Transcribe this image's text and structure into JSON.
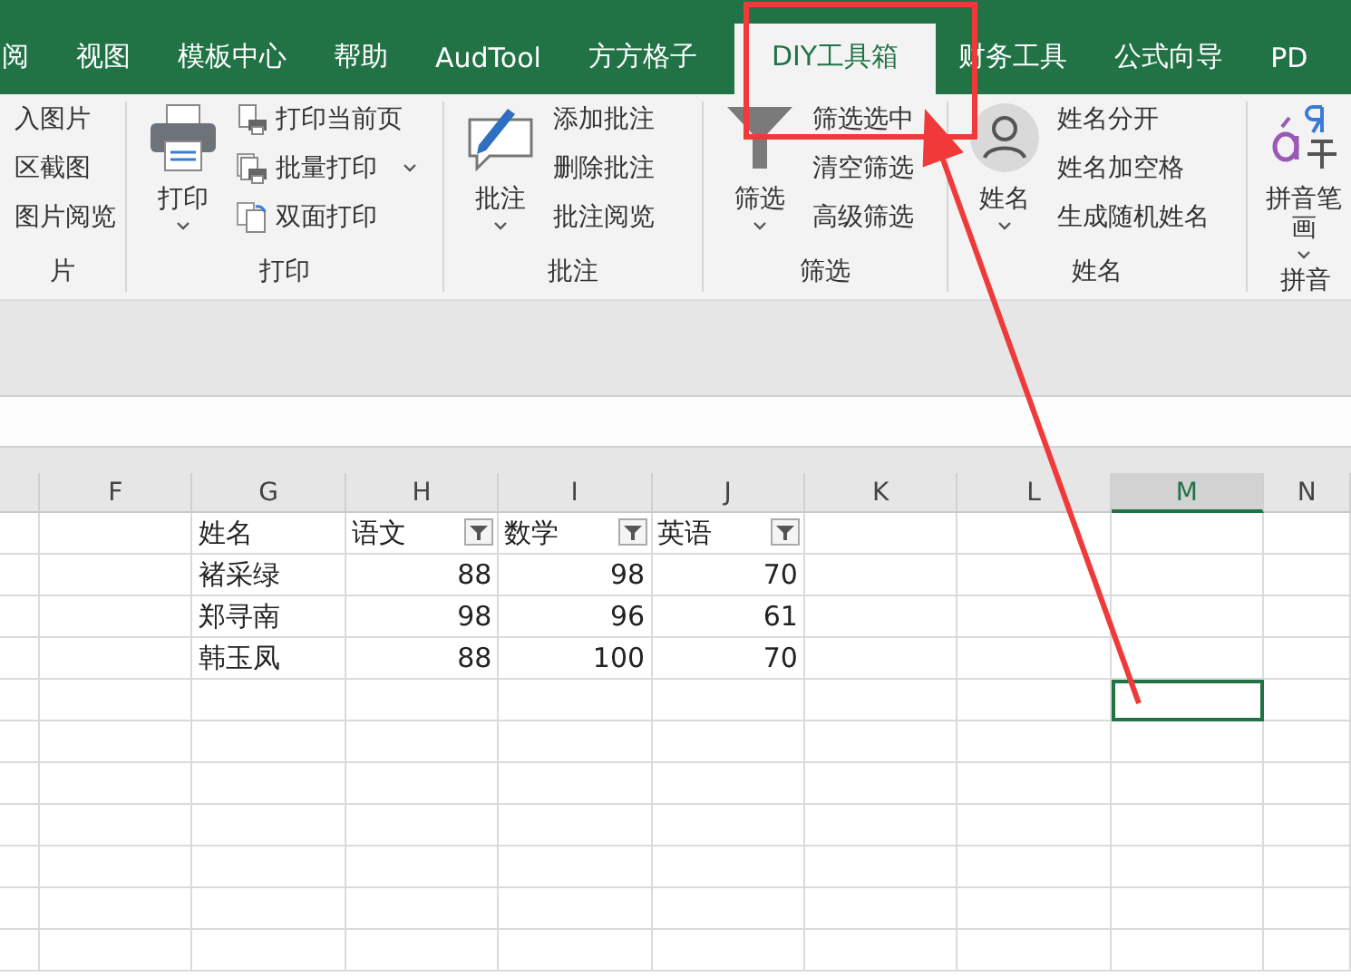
{
  "tabs": [
    {
      "label": "阅",
      "selected": false
    },
    {
      "label": "视图",
      "selected": false
    },
    {
      "label": "模板中心",
      "selected": false
    },
    {
      "label": "帮助",
      "selected": false
    },
    {
      "label": "AudTool",
      "selected": false
    },
    {
      "label": "方方格子",
      "selected": false
    },
    {
      "label": "DIY工具箱",
      "selected": true
    },
    {
      "label": "财务工具",
      "selected": false
    },
    {
      "label": "公式向导",
      "selected": false
    },
    {
      "label": "PD",
      "selected": false
    }
  ],
  "ribbon": {
    "groups": [
      {
        "label": "片",
        "small": [
          {
            "label": "入图片",
            "kind": "text",
            "menu": false
          },
          {
            "label": "区截图",
            "kind": "text",
            "menu": false
          },
          {
            "label": "图片阅览",
            "kind": "text",
            "menu": false
          }
        ]
      },
      {
        "label": "打印",
        "large": [
          {
            "label": "打印",
            "kind": "printer",
            "menu": true
          }
        ],
        "small": [
          {
            "label": "打印当前页",
            "kind": "print-page",
            "menu": false
          },
          {
            "label": "批量打印",
            "kind": "batch-print",
            "menu": true
          },
          {
            "label": "双面打印",
            "kind": "duplex",
            "menu": false
          }
        ]
      },
      {
        "label": "批注",
        "large": [
          {
            "label": "批注",
            "kind": "comment",
            "menu": true
          }
        ],
        "small": [
          {
            "label": "添加批注",
            "kind": "text",
            "menu": false
          },
          {
            "label": "删除批注",
            "kind": "text",
            "menu": false
          },
          {
            "label": "批注阅览",
            "kind": "text",
            "menu": false
          }
        ]
      },
      {
        "label": "筛选",
        "large": [
          {
            "label": "筛选",
            "kind": "filter",
            "menu": true
          }
        ],
        "small": [
          {
            "label": "筛选选中",
            "kind": "text",
            "menu": false
          },
          {
            "label": "清空筛选",
            "kind": "text",
            "menu": false
          },
          {
            "label": "高级筛选",
            "kind": "text",
            "menu": false
          }
        ]
      },
      {
        "label": "姓名",
        "large": [
          {
            "label": "姓名",
            "kind": "person",
            "menu": true
          }
        ],
        "small": [
          {
            "label": "姓名分开",
            "kind": "text",
            "menu": false
          },
          {
            "label": "姓名加空格",
            "kind": "text",
            "menu": false
          },
          {
            "label": "生成随机姓名",
            "kind": "text",
            "menu": false
          }
        ]
      },
      {
        "label": "拼音",
        "large": [
          {
            "label": "拼音笔画",
            "kind": "pinyin",
            "menu": true
          }
        ]
      }
    ]
  },
  "sheet": {
    "columns": [
      {
        "label": "F",
        "selected": false
      },
      {
        "label": "G",
        "selected": false
      },
      {
        "label": "H",
        "selected": false
      },
      {
        "label": "I",
        "selected": false
      },
      {
        "label": "J",
        "selected": false
      },
      {
        "label": "K",
        "selected": false
      },
      {
        "label": "L",
        "selected": false
      },
      {
        "label": "M",
        "selected": true
      },
      {
        "label": "N",
        "selected": false
      }
    ],
    "rows": [
      {
        "selected": false,
        "cells": [
          {
            "text": "",
            "kind": "text",
            "filter": false
          },
          {
            "text": "姓名",
            "kind": "text",
            "filter": false
          },
          {
            "text": "语文",
            "kind": "text",
            "filter": true
          },
          {
            "text": "数学",
            "kind": "text",
            "filter": true
          },
          {
            "text": "英语",
            "kind": "text",
            "filter": true
          }
        ]
      },
      {
        "selected": false,
        "cells": [
          {
            "text": "",
            "kind": "text",
            "filter": false
          },
          {
            "text": "褚采绿",
            "kind": "text",
            "filter": false
          },
          {
            "text": "88",
            "kind": "number",
            "filter": false
          },
          {
            "text": "98",
            "kind": "number",
            "filter": false
          },
          {
            "text": "70",
            "kind": "number",
            "filter": false
          }
        ]
      },
      {
        "selected": false,
        "cells": [
          {
            "text": "",
            "kind": "text",
            "filter": false
          },
          {
            "text": "郑寻南",
            "kind": "text",
            "filter": false
          },
          {
            "text": "98",
            "kind": "number",
            "filter": false
          },
          {
            "text": "96",
            "kind": "number",
            "filter": false
          },
          {
            "text": "61",
            "kind": "number",
            "filter": false
          }
        ]
      },
      {
        "selected": false,
        "cells": [
          {
            "text": "",
            "kind": "text",
            "filter": false
          },
          {
            "text": "韩玉凤",
            "kind": "text",
            "filter": false
          },
          {
            "text": "88",
            "kind": "number",
            "filter": false
          },
          {
            "text": "100",
            "kind": "number",
            "filter": false
          },
          {
            "text": "70",
            "kind": "number",
            "filter": false
          }
        ]
      },
      {
        "selected": true,
        "cells": []
      },
      {
        "selected": false,
        "cells": []
      },
      {
        "selected": false,
        "cells": []
      },
      {
        "selected": false,
        "cells": []
      },
      {
        "selected": false,
        "cells": []
      },
      {
        "selected": false,
        "cells": []
      },
      {
        "selected": false,
        "cells": []
      }
    ]
  }
}
